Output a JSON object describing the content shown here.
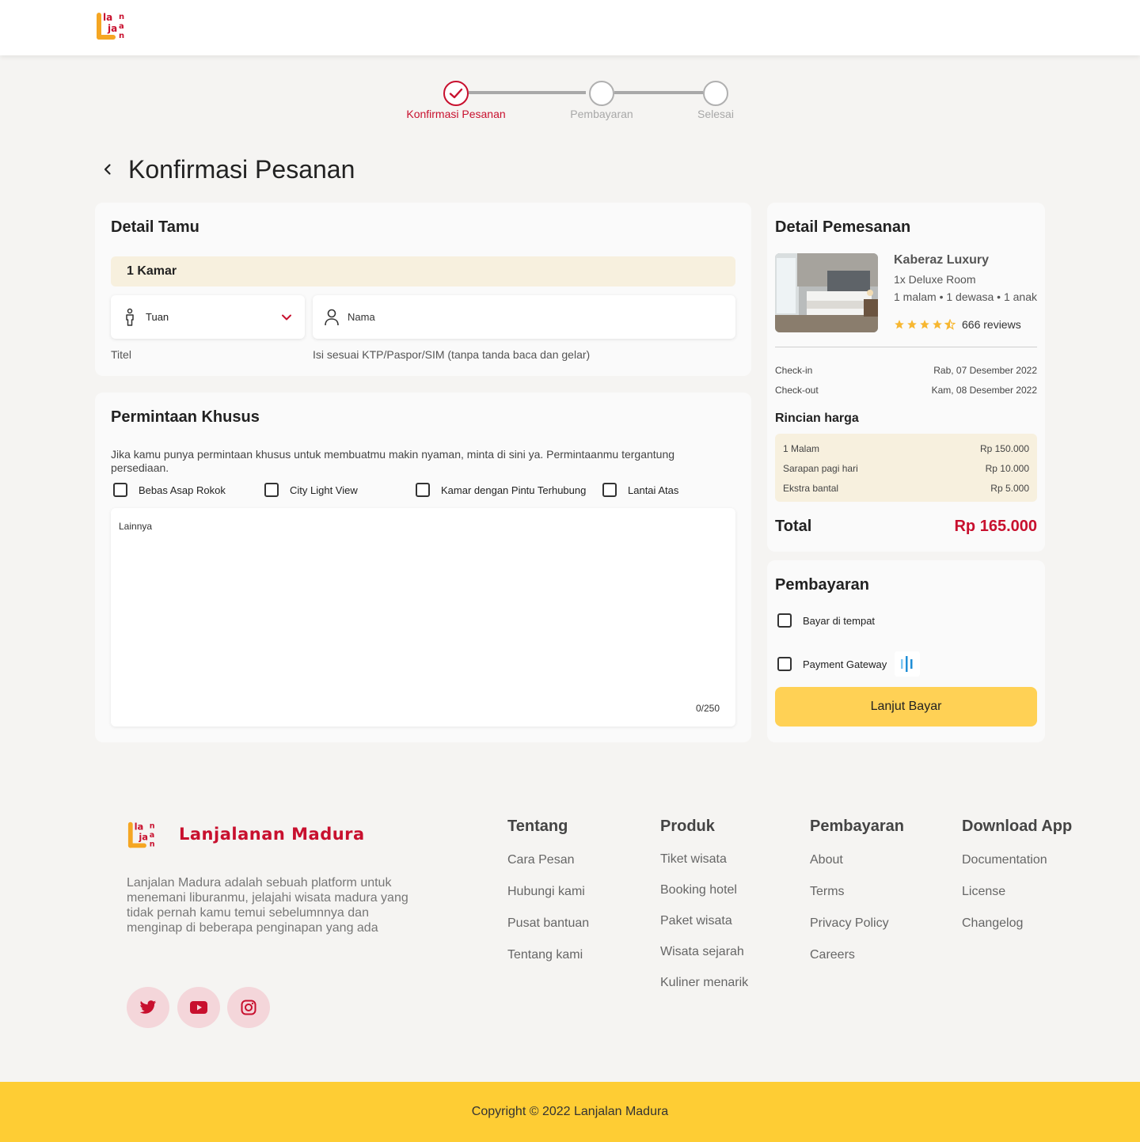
{
  "stepper": {
    "steps": [
      {
        "label": "Konfirmasi Pesanan"
      },
      {
        "label": "Pembayaran"
      },
      {
        "label": "Selesai"
      }
    ]
  },
  "page": {
    "title": "Konfirmasi Pesanan"
  },
  "guest": {
    "title": "Detail Tamu",
    "room": "1 Kamar",
    "salutation_value": "Tuan",
    "name_placeholder": "Nama",
    "salutation_helper": "Titel",
    "name_helper": "Isi sesuai KTP/Paspor/SIM (tanpa tanda baca dan gelar)"
  },
  "requests": {
    "title": "Permintaan Khusus",
    "description": "Jika kamu punya permintaan khusus untuk membuatmu makin nyaman, minta di sini ya. Permintaanmu tergantung persediaan.",
    "options": [
      "Bebas Asap Rokok",
      "City Light View",
      "Kamar dengan Pintu Terhubung",
      "Lantai Atas"
    ],
    "other_placeholder": "Lainnya",
    "counter": "0/250"
  },
  "booking": {
    "title": "Detail Pemesanan",
    "hotel_name": "Kaberaz Luxury",
    "room_type": "1x Deluxe Room",
    "stay_info": "1 malam • 1 dewasa • 1 anak",
    "rating": 4.5,
    "reviews": "666 reviews",
    "checkin_label": "Check-in",
    "checkin_value": "Rab, 07 Desember 2022",
    "checkout_label": "Check-out",
    "checkout_value": "Kam, 08 Desember 2022",
    "price_title": "Rincian harga",
    "price_items": [
      {
        "label": "1 Malam",
        "value": "Rp 150.000"
      },
      {
        "label": "Sarapan pagi hari",
        "value": "Rp 10.000"
      },
      {
        "label": "Ekstra bantal",
        "value": "Rp 5.000"
      }
    ],
    "total_label": "Total",
    "total_value": "Rp 165.000"
  },
  "payment": {
    "title": "Pembayaran",
    "options": [
      "Bayar di tempat",
      "Payment Gateway"
    ],
    "button": "Lanjut Bayar"
  },
  "footer": {
    "brand": "Lanjalanan Madura",
    "description": "Lanjalan Madura adalah sebuah platform untuk menemani liburanmu, jelajahi wisata madura yang tidak pernah kamu temui sebelumnnya dan menginap di beberapa penginapan yang ada",
    "columns": [
      {
        "title": "Tentang",
        "links": [
          "Cara Pesan",
          "Hubungi kami",
          "Pusat bantuan",
          "Tentang kami"
        ]
      },
      {
        "title": "Produk",
        "links": [
          "Tiket wisata",
          "Booking hotel",
          "Paket wisata",
          "Wisata sejarah",
          "Kuliner menarik"
        ]
      },
      {
        "title": "Pembayaran",
        "links": [
          "About",
          "Terms",
          "Privacy Policy",
          "Careers"
        ]
      },
      {
        "title": "Download App",
        "links": [
          "Documentation",
          "License",
          "Changelog"
        ]
      }
    ],
    "social": [
      "twitter-icon",
      "youtube-icon",
      "instagram-icon"
    ],
    "copyright": "Copyright © 2022 Lanjalan Madura"
  },
  "colors": {
    "brand_red": "#c8102e",
    "accent_yellow": "#fecd34",
    "button_yellow": "#ffd155"
  }
}
